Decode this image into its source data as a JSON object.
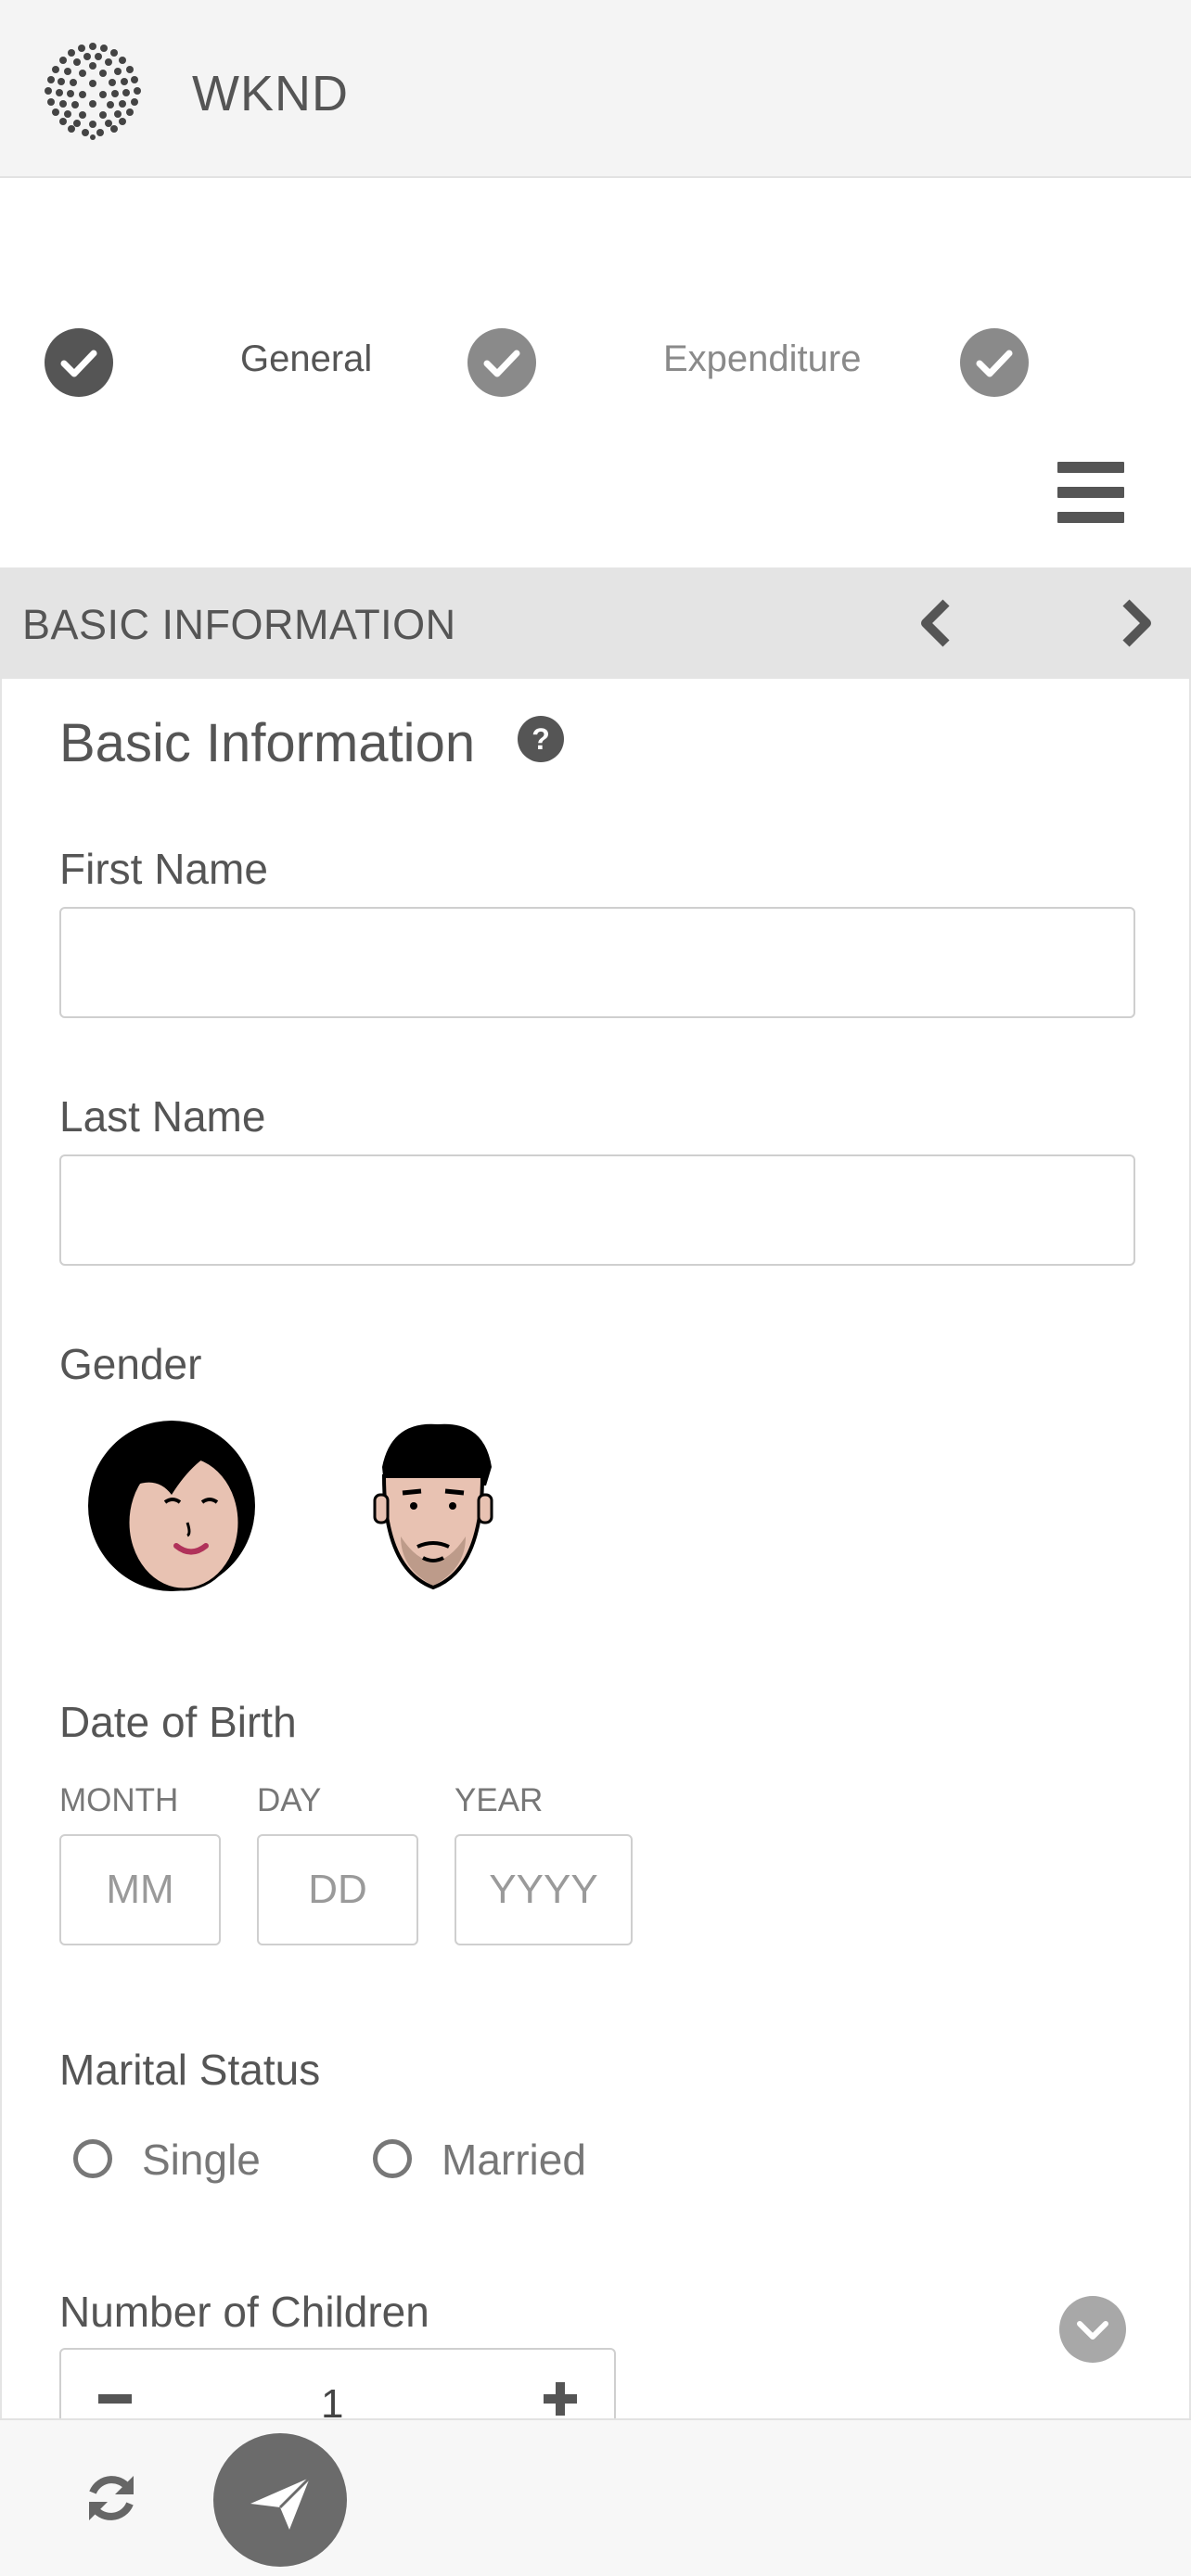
{
  "header": {
    "brand": "WKND"
  },
  "steps": [
    {
      "label": "",
      "state": "complete",
      "check_color": "#555555"
    },
    {
      "label": "General",
      "state": "current",
      "check_color": "#8a8a8a"
    },
    {
      "label": "Expenditure",
      "state": "complete",
      "check_color": "#8a8a8a"
    }
  ],
  "section_bar": {
    "title": "BASIC INFORMATION"
  },
  "form": {
    "title": "Basic Information",
    "help_icon_label": "?",
    "first_name": {
      "label": "First Name",
      "value": ""
    },
    "last_name": {
      "label": "Last Name",
      "value": ""
    },
    "gender": {
      "label": "Gender",
      "options": [
        "female",
        "male"
      ]
    },
    "dob": {
      "label": "Date of Birth",
      "month": {
        "label": "MONTH",
        "placeholder": "MM"
      },
      "day": {
        "label": "DAY",
        "placeholder": "DD"
      },
      "year": {
        "label": "YEAR",
        "placeholder": "YYYY"
      }
    },
    "marital_status": {
      "label": "Marital Status",
      "options": [
        "Single",
        "Married"
      ]
    },
    "children": {
      "label": "Number of Children",
      "value": "1"
    }
  },
  "colors": {
    "text": "#555555",
    "header_bg": "#f4f4f4",
    "section_bg": "#e4e4e4",
    "button": "#6b6b6b"
  }
}
